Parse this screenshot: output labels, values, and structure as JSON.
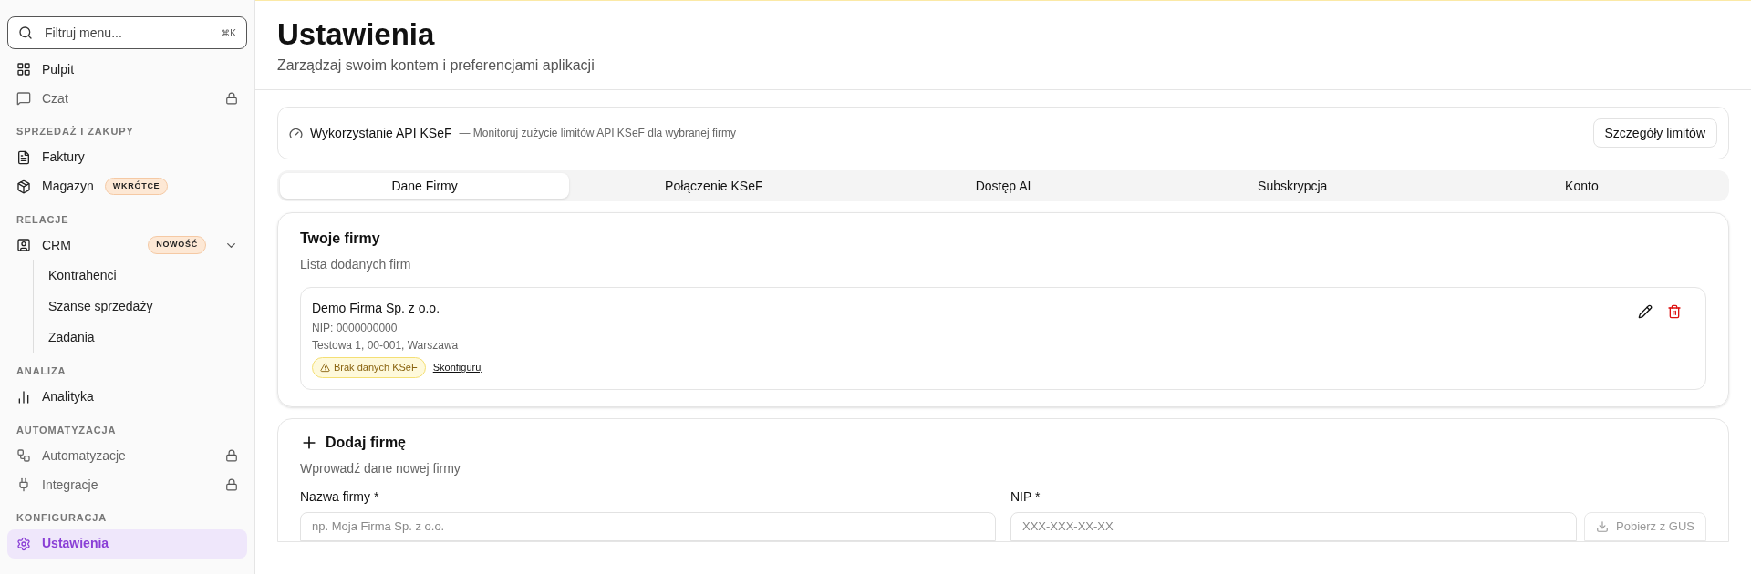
{
  "sidebar": {
    "search": {
      "placeholder": "Filtruj menu...",
      "shortcut": "⌘K"
    },
    "sections": [
      {
        "items": [
          {
            "label": "Pulpit",
            "locked": false,
            "selected": false
          },
          {
            "label": "Czat",
            "locked": true,
            "selected": false
          }
        ]
      },
      {
        "heading": "SPRZEDAŻ I ZAKUPY",
        "items": [
          {
            "label": "Faktury",
            "locked": false,
            "selected": false
          },
          {
            "label": "Magazyn",
            "locked": false,
            "selected": false,
            "badge": "WKRÓTCE"
          }
        ]
      },
      {
        "heading": "RELACJE",
        "items": [
          {
            "label": "CRM",
            "locked": false,
            "selected": false,
            "badge": "NOWOŚĆ",
            "expanded": true,
            "children": [
              {
                "label": "Kontrahenci"
              },
              {
                "label": "Szanse sprzedaży"
              },
              {
                "label": "Zadania"
              }
            ]
          }
        ]
      },
      {
        "heading": "ANALIZA",
        "items": [
          {
            "label": "Analityka",
            "locked": false,
            "selected": false
          }
        ]
      },
      {
        "heading": "AUTOMATYZACJA",
        "items": [
          {
            "label": "Automatyzacje",
            "locked": true,
            "selected": false
          },
          {
            "label": "Integracje",
            "locked": true,
            "selected": false
          }
        ]
      },
      {
        "heading": "KONFIGURACJA",
        "items": [
          {
            "label": "Ustawienia",
            "locked": false,
            "selected": true
          }
        ]
      }
    ]
  },
  "header": {
    "title": "Ustawienia",
    "subtitle": "Zarządzaj swoim kontem i preferencjami aplikacji"
  },
  "api_usage": {
    "title": "Wykorzystanie API KSeF",
    "description": "— Monitoruj zużycie limitów API KSeF dla wybranej firmy",
    "button": "Szczegóły limitów"
  },
  "tabs": [
    {
      "label": "Dane Firmy",
      "selected": true
    },
    {
      "label": "Połączenie KSeF",
      "selected": false
    },
    {
      "label": "Dostęp AI",
      "selected": false
    },
    {
      "label": "Subskrypcja",
      "selected": false
    },
    {
      "label": "Konto",
      "selected": false
    }
  ],
  "companies": {
    "title": "Twoje firmy",
    "subtitle": "Lista dodanych firm",
    "items": [
      {
        "name": "Demo Firma Sp. z o.o.",
        "nip": "NIP: 0000000000",
        "address": "Testowa 1, 00-001, Warszawa",
        "warning": "Brak danych KSeF",
        "link": "Skonfiguruj"
      }
    ]
  },
  "add_company": {
    "title": "Dodaj firmę",
    "subtitle": "Wprowadź dane nowej firmy",
    "fields": [
      {
        "label": "Nazwa firmy *",
        "placeholder": "np. Moja Firma Sp. z o.o."
      },
      {
        "label": "NIP *",
        "placeholder": "XXX-XXX-XX-XX",
        "button": "Pobierz z GUS"
      }
    ]
  }
}
